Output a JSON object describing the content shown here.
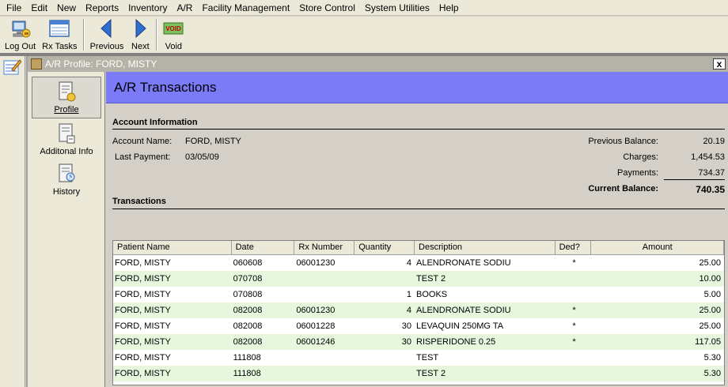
{
  "menu": [
    "File",
    "Edit",
    "New",
    "Reports",
    "Inventory",
    "A/R",
    "Facility Management",
    "Store Control",
    "System Utilities",
    "Help"
  ],
  "toolbar": {
    "logout": "Log Out",
    "rx_tasks": "Rx Tasks",
    "previous": "Previous",
    "next": "Next",
    "void": "Void",
    "void_icon_text": "VOID"
  },
  "window": {
    "title": "A/R Profile: FORD, MISTY",
    "close": "x"
  },
  "sidebar": {
    "items": [
      {
        "label": "Profile",
        "icon": "profile-icon"
      },
      {
        "label": "Additonal Info",
        "icon": "additional-info-icon"
      },
      {
        "label": "History",
        "icon": "history-icon"
      }
    ]
  },
  "banner": {
    "title": "A/R Transactions"
  },
  "account": {
    "section": "Account Information",
    "name_label": "Account Name:",
    "name_value": "FORD, MISTY",
    "last_payment_label": "Last Payment:",
    "last_payment_value": "03/05/09",
    "prev_balance_label": "Previous Balance:",
    "prev_balance_value": "20.19",
    "charges_label": "Charges:",
    "charges_value": "1,454.53",
    "payments_label": "Payments:",
    "payments_value": "734.37",
    "current_balance_label": "Current Balance:",
    "current_balance_value": "740.35"
  },
  "transactions": {
    "section": "Transactions",
    "columns": [
      "Patient Name",
      "Date",
      "Rx Number",
      "Quantity",
      "Description",
      "Ded?",
      "Amount"
    ],
    "rows": [
      {
        "patient": "FORD, MISTY",
        "date": "060608",
        "rx": "06001230",
        "qty": "4",
        "desc": "ALENDRONATE SODIU",
        "ded": "*",
        "amount": "25.00"
      },
      {
        "patient": "FORD, MISTY",
        "date": "070708",
        "rx": "",
        "qty": "",
        "desc": "TEST 2",
        "ded": "",
        "amount": "10.00"
      },
      {
        "patient": "FORD, MISTY",
        "date": "070808",
        "rx": "",
        "qty": "1",
        "desc": "BOOKS",
        "ded": "",
        "amount": "5.00"
      },
      {
        "patient": "FORD, MISTY",
        "date": "082008",
        "rx": "06001230",
        "qty": "4",
        "desc": "ALENDRONATE SODIU",
        "ded": "*",
        "amount": "25.00"
      },
      {
        "patient": "FORD, MISTY",
        "date": "082008",
        "rx": "06001228",
        "qty": "30",
        "desc": "LEVAQUIN 250MG TA",
        "ded": "*",
        "amount": "25.00"
      },
      {
        "patient": "FORD, MISTY",
        "date": "082008",
        "rx": "06001246",
        "qty": "30",
        "desc": "RISPERIDONE 0.25",
        "ded": "*",
        "amount": "117.05"
      },
      {
        "patient": "FORD, MISTY",
        "date": "111808",
        "rx": "",
        "qty": "",
        "desc": "TEST",
        "ded": "",
        "amount": "5.30"
      },
      {
        "patient": "FORD, MISTY",
        "date": "111808",
        "rx": "",
        "qty": "",
        "desc": "TEST 2",
        "ded": "",
        "amount": "5.30"
      }
    ]
  },
  "colors": {
    "banner": "#7b7bf7",
    "alt_row": "#e6f7dd"
  }
}
